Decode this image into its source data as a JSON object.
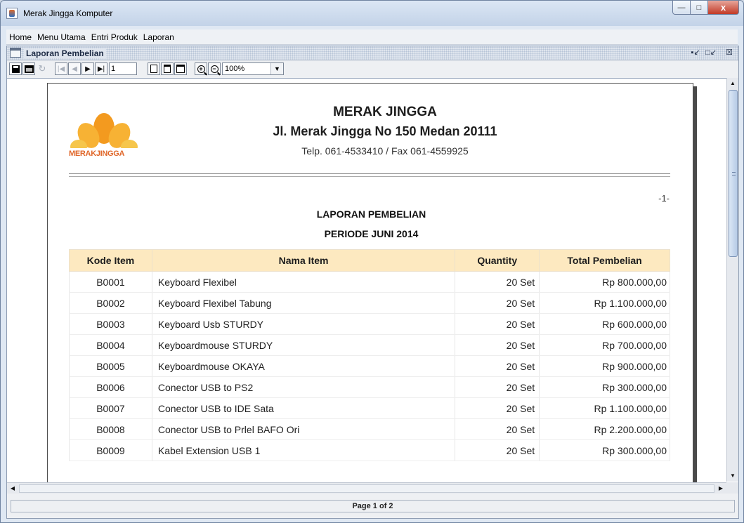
{
  "window": {
    "title": "Merak Jingga Komputer",
    "close_glyph": "x"
  },
  "menu": [
    "Home",
    "Menu Utama",
    "Entri Produk",
    "Laporan"
  ],
  "internal_frame": {
    "title": "Laporan Pembelian"
  },
  "toolbar": {
    "page_input_value": "1",
    "zoom_value": "100%",
    "icons": [
      "save-icon",
      "print-icon",
      "reload-icon",
      "first-page-icon",
      "previous-page-icon",
      "next-page-icon",
      "last-page-icon",
      "actual-size-icon",
      "fit-page-icon",
      "fit-width-icon",
      "zoom-in-icon",
      "zoom-out-icon"
    ]
  },
  "report": {
    "logo_text": "MERAKJINGGA",
    "company": "MERAK JINGGA",
    "address": "Jl. Merak Jingga No 150 Medan 20111",
    "phone": "Telp. 061-4533410 / Fax 061-4559925",
    "page_marker": "-1-",
    "title": "LAPORAN PEMBELIAN",
    "period": "PERIODE JUNI 2014",
    "columns": [
      "Kode Item",
      "Nama Item",
      "Quantity",
      "Total Pembelian"
    ],
    "rows": [
      {
        "kode": "B0001",
        "nama": "Keyboard Flexibel",
        "qty": "20 Set",
        "total": "Rp 800.000,00"
      },
      {
        "kode": "B0002",
        "nama": "Keyboard Flexibel Tabung",
        "qty": "20 Set",
        "total": "Rp 1.100.000,00"
      },
      {
        "kode": "B0003",
        "nama": "Keyboard Usb STURDY",
        "qty": "20 Set",
        "total": "Rp 600.000,00"
      },
      {
        "kode": "B0004",
        "nama": "Keyboardmouse STURDY",
        "qty": "20 Set",
        "total": "Rp 700.000,00"
      },
      {
        "kode": "B0005",
        "nama": "Keyboardmouse OKAYA",
        "qty": "20 Set",
        "total": "Rp 900.000,00"
      },
      {
        "kode": "B0006",
        "nama": "Conector USB to PS2",
        "qty": "20 Set",
        "total": "Rp 300.000,00"
      },
      {
        "kode": "B0007",
        "nama": "Conector USB to IDE Sata",
        "qty": "20 Set",
        "total": "Rp 1.100.000,00"
      },
      {
        "kode": "B0008",
        "nama": "Conector USB to Prlel BAFO Ori",
        "qty": "20 Set",
        "total": "Rp 2.200.000,00"
      },
      {
        "kode": "B0009",
        "nama": "Kabel Extension USB 1",
        "qty": "20 Set",
        "total": "Rp 300.000,00"
      }
    ]
  },
  "status": {
    "page_label": "Page 1 of 2"
  },
  "colors": {
    "header_fill": "#fde9c0",
    "logo_orange": "#e0672a"
  }
}
